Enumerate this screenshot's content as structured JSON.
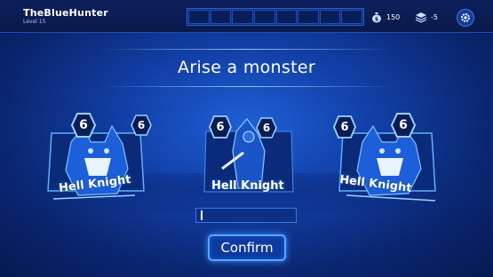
{
  "player": {
    "name": "TheBlueHunter",
    "level": "Level 15"
  },
  "resources": [
    {
      "icon": "money-bag-icon",
      "value": "150"
    },
    {
      "icon": "stack-layers-icon",
      "value": "-5"
    }
  ],
  "title": "Arise a monster",
  "cards": [
    {
      "name": "Hell Knight",
      "level": "6",
      "power": "6"
    },
    {
      "name": "Hell Knight",
      "level": "6",
      "power": "6"
    },
    {
      "name": "Hell Knight",
      "level": "6",
      "power": "6"
    }
  ],
  "input": {
    "value": ""
  },
  "confirm_label": "Confirm",
  "colors": {
    "accent": "#59a6ff",
    "background": "#1240a8",
    "topbar": "#0a1a4a"
  }
}
